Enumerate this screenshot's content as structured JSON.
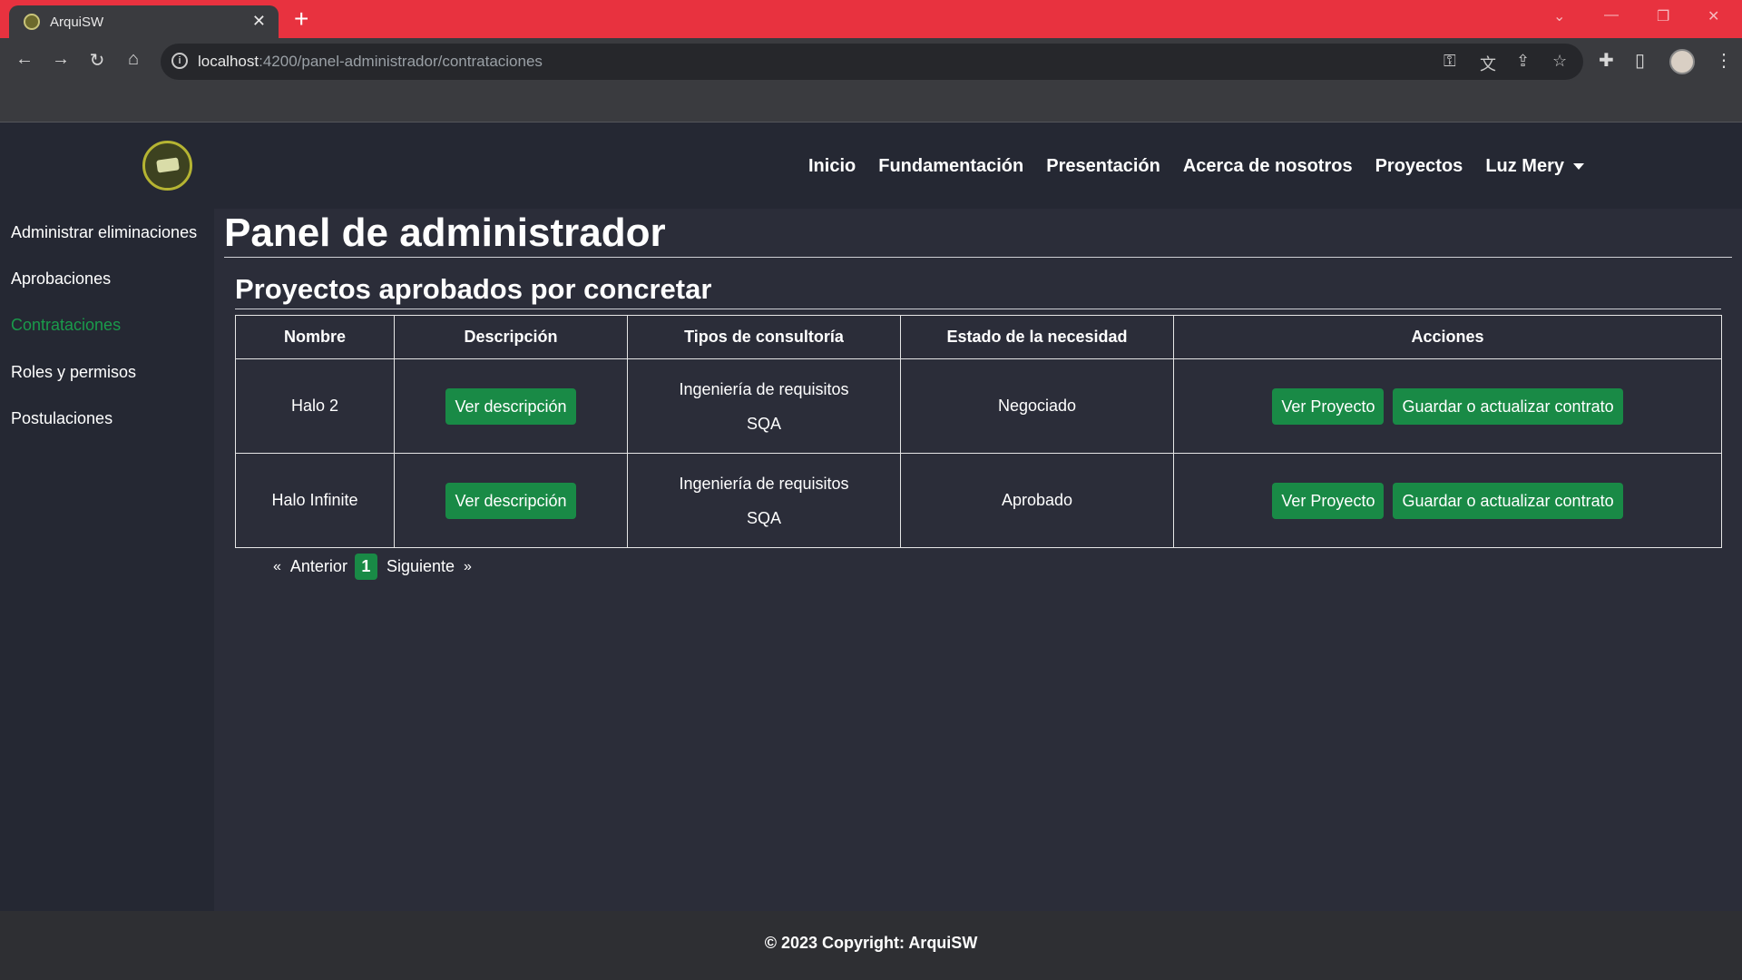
{
  "browser": {
    "tab_title": "ArquiSW",
    "tab_close": "✕",
    "new_tab": "+",
    "url_host": "localhost",
    "url_path": ":4200/panel-administrador/contrataciones"
  },
  "header": {
    "nav": [
      "Inicio",
      "Fundamentación",
      "Presentación",
      "Acerca de nosotros",
      "Proyectos"
    ],
    "user": "Luz Mery"
  },
  "sidebar": {
    "items": [
      "Administrar eliminaciones",
      "Aprobaciones",
      "Contrataciones",
      "Roles y permisos",
      "Postulaciones"
    ],
    "active": "Contrataciones"
  },
  "main": {
    "title": "Panel de administrador",
    "section_title": "Proyectos aprobados por concretar",
    "table": {
      "headers": [
        "Nombre",
        "Descripción",
        "Tipos de consultoría",
        "Estado de la necesidad",
        "Acciones"
      ],
      "rows": [
        {
          "nombre": "Halo 2",
          "desc_button": "Ver descripción",
          "tipos": [
            "Ingeniería de requisitos",
            "SQA"
          ],
          "estado": "Negociado",
          "actions": [
            "Ver Proyecto",
            "Guardar o actualizar contrato"
          ]
        },
        {
          "nombre": "Halo Infinite",
          "desc_button": "Ver descripción",
          "tipos": [
            "Ingeniería de requisitos",
            "SQA"
          ],
          "estado": "Aprobado",
          "actions": [
            "Ver Proyecto",
            "Guardar o actualizar contrato"
          ]
        }
      ]
    },
    "pagination": {
      "prev_arrow": "«",
      "prev": "Anterior",
      "current": "1",
      "next": "Siguiente",
      "next_arrow": "»"
    }
  },
  "footer": {
    "text": "© 2023 Copyright: ArquiSW"
  },
  "colors": {
    "accent_green": "#198a46",
    "active_link": "#1a9b4b",
    "tabbar_red": "#e8323f"
  }
}
